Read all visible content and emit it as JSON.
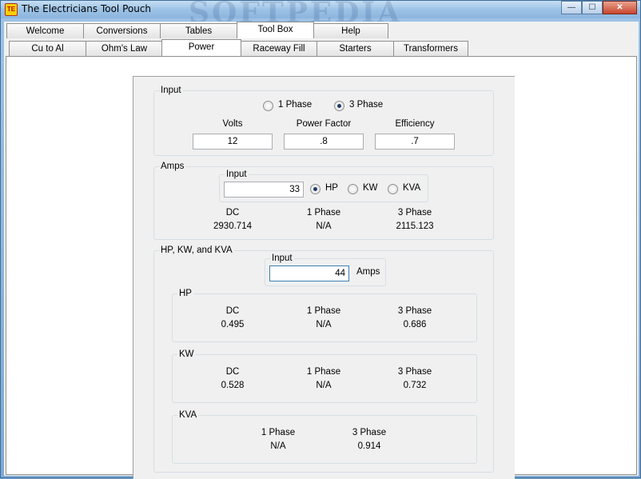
{
  "window": {
    "title": "The Electricians Tool Pouch",
    "icon_text": "TE",
    "watermark": "SOFTPEDIA"
  },
  "caption": {
    "minimize": "—",
    "maximize": "☐",
    "close": "✕"
  },
  "main_tabs": [
    "Welcome",
    "Conversions",
    "Tables",
    "Tool Box",
    "Help"
  ],
  "sub_tabs": [
    "Cu to Al",
    "Ohm's Law",
    "Power",
    "Raceway Fill",
    "Starters",
    "Transformers"
  ],
  "input_group": {
    "label": "Input",
    "phase_options": [
      "1 Phase",
      "3 Phase"
    ],
    "selected_phase": "3 Phase",
    "fields": [
      {
        "label": "Volts",
        "value": "12"
      },
      {
        "label": "Power Factor",
        "value": ".8"
      },
      {
        "label": "Efficiency",
        "value": ".7"
      }
    ]
  },
  "amps_group": {
    "label": "Amps",
    "input_label": "Input",
    "input_value": "33",
    "units": [
      "HP",
      "KW",
      "KVA"
    ],
    "selected_unit": "HP",
    "results": [
      {
        "label": "DC",
        "value": "2930.714"
      },
      {
        "label": "1 Phase",
        "value": "N/A"
      },
      {
        "label": "3 Phase",
        "value": "2115.123"
      }
    ]
  },
  "power_group": {
    "label": "HP, KW, and KVA",
    "input_label": "Input",
    "input_value": "44",
    "input_unit": "Amps",
    "hp": {
      "label": "HP",
      "results": [
        {
          "label": "DC",
          "value": "0.495"
        },
        {
          "label": "1 Phase",
          "value": "N/A"
        },
        {
          "label": "3 Phase",
          "value": "0.686"
        }
      ]
    },
    "kw": {
      "label": "KW",
      "results": [
        {
          "label": "DC",
          "value": "0.528"
        },
        {
          "label": "1 Phase",
          "value": "N/A"
        },
        {
          "label": "3 Phase",
          "value": "0.732"
        }
      ]
    },
    "kva": {
      "label": "KVA",
      "results": [
        {
          "label": "1 Phase",
          "value": "N/A"
        },
        {
          "label": "3 Phase",
          "value": "0.914"
        }
      ]
    }
  }
}
